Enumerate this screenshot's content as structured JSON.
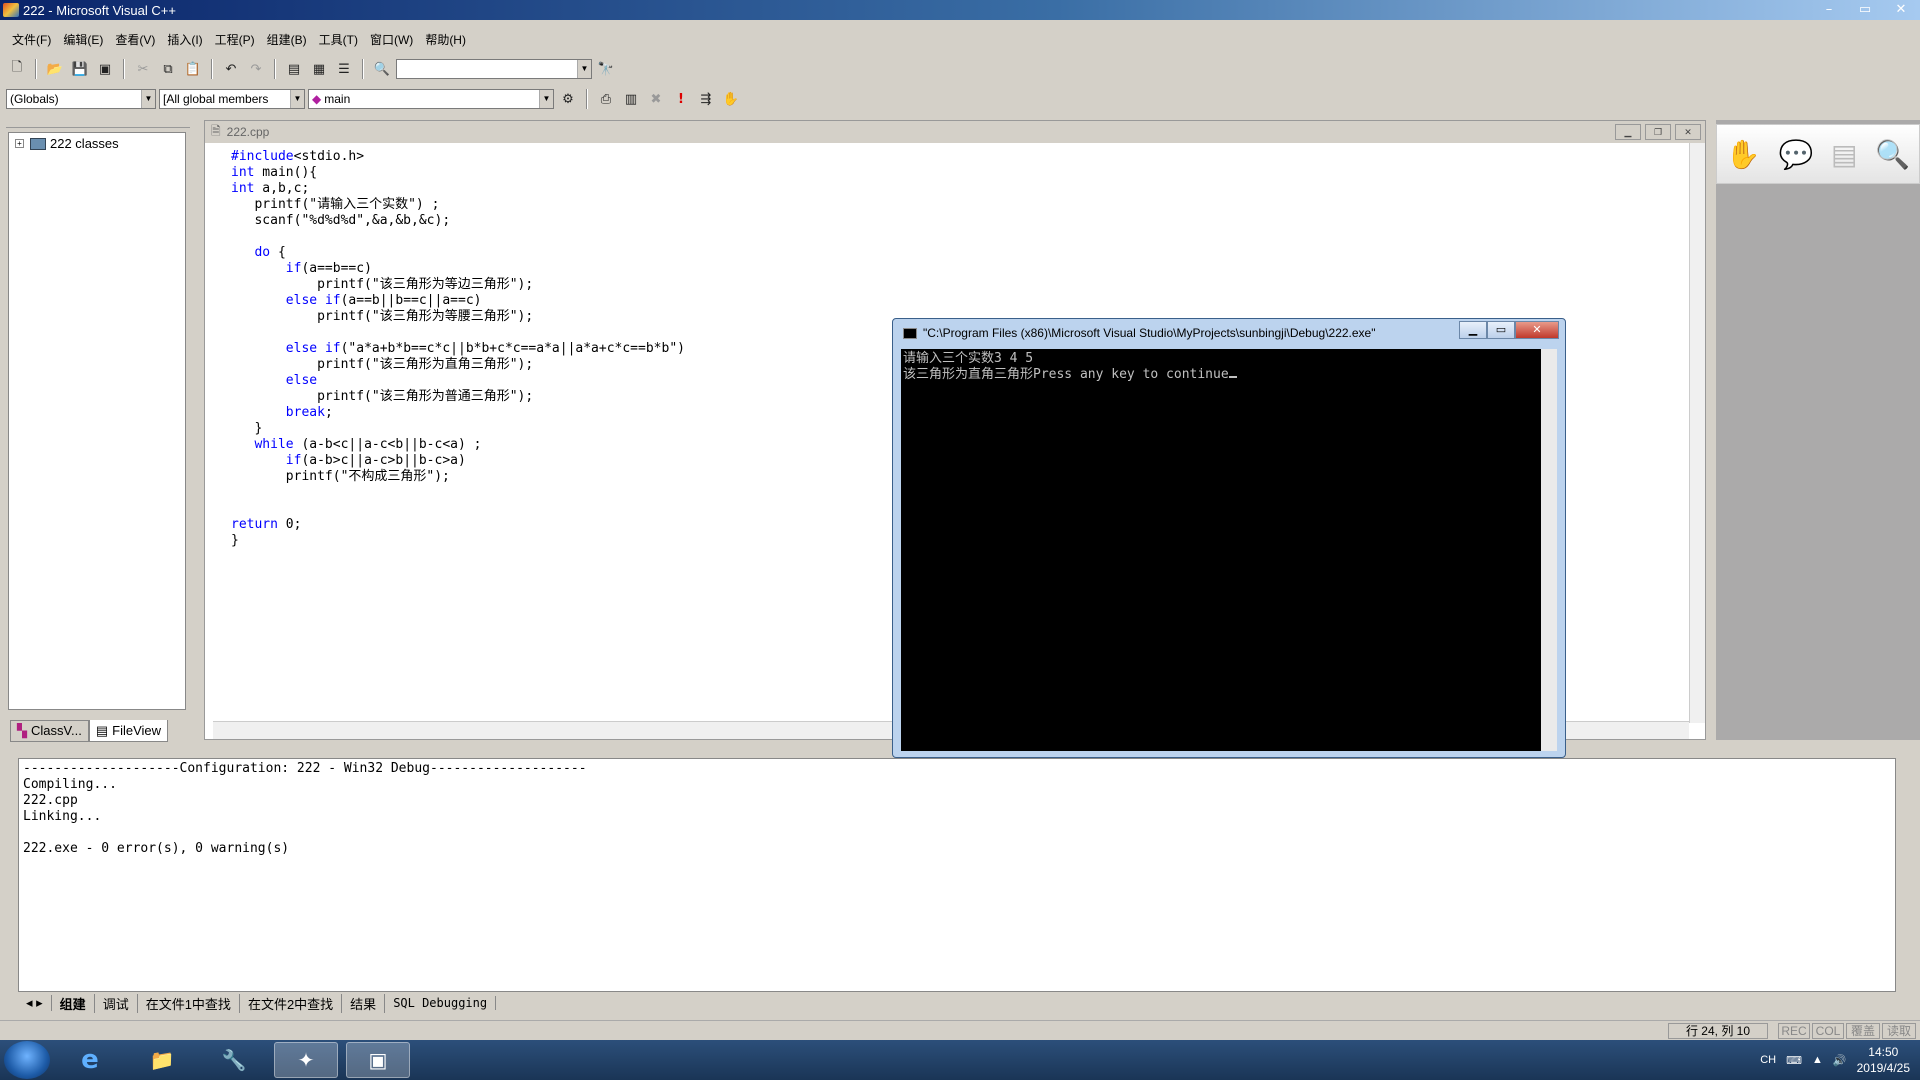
{
  "window": {
    "title": "222 - Microsoft Visual C++",
    "min": "–",
    "max": "▭",
    "close": "✕"
  },
  "menu": [
    "文件(F)",
    "编辑(E)",
    "查看(V)",
    "插入(I)",
    "工程(P)",
    "组建(B)",
    "工具(T)",
    "窗口(W)",
    "帮助(H)"
  ],
  "combos": {
    "scope": "(Globals)",
    "members": "[All global members",
    "function": "main"
  },
  "workspace": {
    "tree_root": "222 classes",
    "tabs": [
      "ClassV...",
      "FileView"
    ]
  },
  "editor": {
    "filename": "222.cpp",
    "code_lines": [
      "#include<stdio.h>",
      "int main(){",
      "int a,b,c;",
      "   printf(\"请输入三个实数\") ;",
      "   scanf(\"%d%d%d\",&a,&b,&c);",
      "",
      "   do {",
      "       if(a==b==c)",
      "           printf(\"该三角形为等边三角形\");",
      "       else if(a==b||b==c||a==c)",
      "           printf(\"该三角形为等腰三角形\");",
      "",
      "       else if(\"a*a+b*b==c*c||b*b+c*c==a*a||a*a+c*c==b*b\")",
      "           printf(\"该三角形为直角三角形\");",
      "       else",
      "           printf(\"该三角形为普通三角形\");",
      "       break;",
      "   }",
      "   while (a-b<c||a-c<b||b-c<a) ;",
      "       if(a-b>c||a-c>b||b-c>a)",
      "       printf(\"不构成三角形\");",
      "",
      "",
      "return 0;",
      "}"
    ]
  },
  "console": {
    "title": "\"C:\\Program Files (x86)\\Microsoft Visual Studio\\MyProjects\\sunbingji\\Debug\\222.exe\"",
    "lines": [
      "请输入三个实数3 4 5",
      "该三角形为直角三角形Press any key to continue"
    ]
  },
  "output": {
    "lines": [
      "--------------------Configuration: 222 - Win32 Debug--------------------",
      "Compiling...",
      "222.cpp",
      "Linking...",
      "",
      "222.exe - 0 error(s), 0 warning(s)"
    ],
    "tabs": [
      "组建",
      "调试",
      "在文件1中查找",
      "在文件2中查找",
      "结果",
      "SQL Debugging"
    ]
  },
  "status": {
    "position": "行 24, 列 10",
    "rec": "REC",
    "col": "COL",
    "ovr": "覆盖",
    "read": "读取"
  },
  "taskbar": {
    "lang": "CH",
    "time": "14:50",
    "date": "2019/4/25"
  }
}
